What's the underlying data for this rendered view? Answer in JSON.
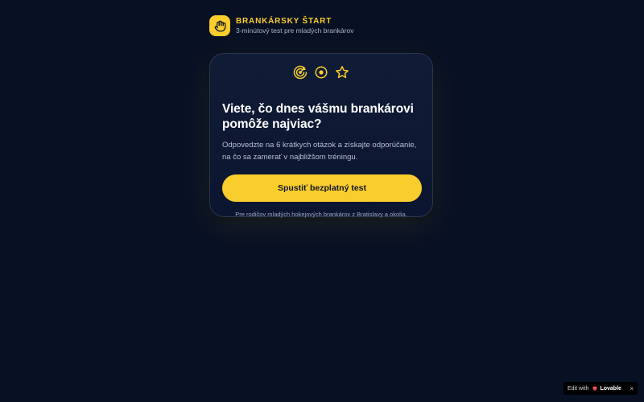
{
  "brand": {
    "logo_icon": "hand-icon",
    "name": "BRANKÁRSKY ŠTART",
    "tagline": "3-minútový test pre mladých brankárov"
  },
  "card": {
    "icons": [
      "target-icon",
      "puck-icon",
      "star-icon"
    ],
    "headline": "Viete, čo dnes vášmu brankárovi pomôže najviac?",
    "description": "Odpovedzte na 6 krátkych otázok a získajte odporúčanie, na čo sa zamerať v najbližšom tréningu.",
    "cta_label": "Spustiť bezplatný test",
    "footnote": "Pre rodičov mladých hokejových brankárov z Bratislavy a okolia."
  },
  "badge": {
    "prefix": "Edit with",
    "brand": "Lovable",
    "close": "×"
  },
  "colors": {
    "background": "#081024",
    "accent": "#f9cd2c",
    "card": "#0f1a33",
    "text": "#ffffff",
    "muted": "#b6bfd1"
  }
}
